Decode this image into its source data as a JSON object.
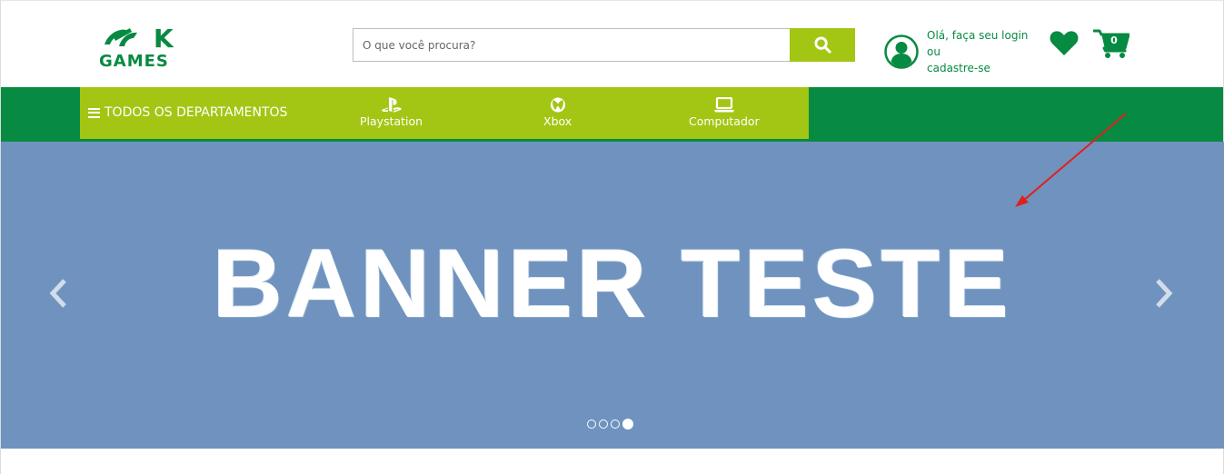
{
  "header": {
    "logo_top": "K",
    "logo_bottom": "GAMES",
    "search": {
      "placeholder": "O que você procura?"
    },
    "account": {
      "line1": "Olá, faça seu login ou",
      "line2": "cadastre-se"
    },
    "cart_count": "0"
  },
  "nav": {
    "departments_label": "TODOS OS DEPARTAMENTOS",
    "items": [
      {
        "label": "Playstation",
        "icon": "playstation-icon"
      },
      {
        "label": "Xbox",
        "icon": "xbox-icon"
      },
      {
        "label": "Computador",
        "icon": "computer-icon"
      }
    ]
  },
  "banner": {
    "text": "BANNER TESTE",
    "slide_count": 4,
    "active_slide": 4
  },
  "colors": {
    "brand_green": "#078a42",
    "accent_lime": "#a3c614",
    "banner_blue": "#6f93be"
  }
}
